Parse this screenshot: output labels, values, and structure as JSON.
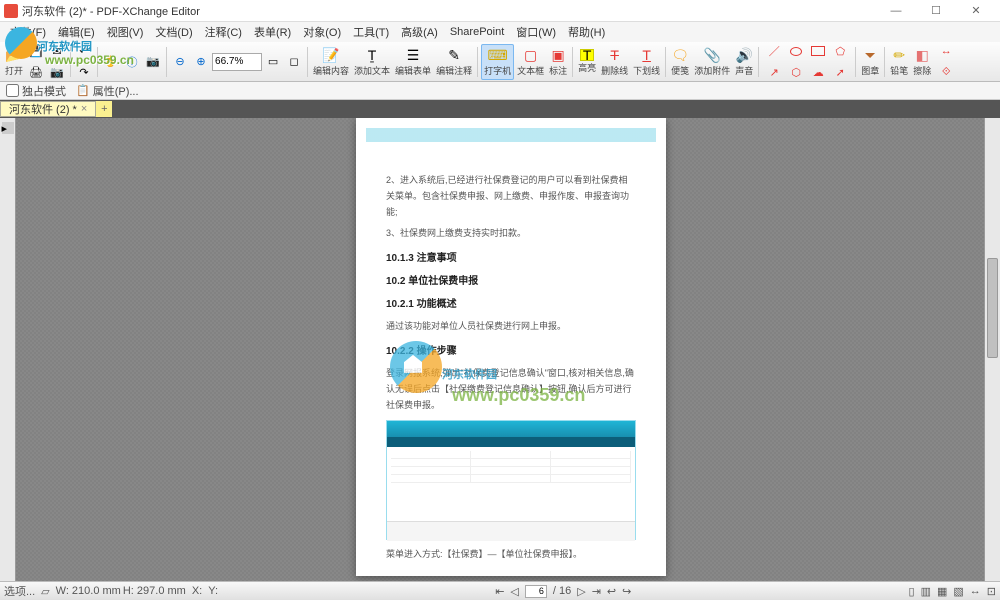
{
  "window": {
    "title": "河东软件 (2)* - PDF-XChange Editor",
    "minimize": "—",
    "maximize": "☐",
    "close": "✕"
  },
  "menu": {
    "file": "文件(F)",
    "edit": "编辑(E)",
    "view": "视图(V)",
    "document": "文档(D)",
    "annotate": "注释(C)",
    "form": "表单(R)",
    "object": "对象(O)",
    "tools": "工具(T)",
    "advanced": "高级(A)",
    "sharepoint": "SharePoint",
    "window": "窗口(W)",
    "help": "帮助(H)"
  },
  "toolbar": {
    "open": "打开",
    "zoom_value": "66.7%",
    "edit_content": "编辑内容",
    "add_text": "添加文本",
    "edit_form": "编辑表单",
    "edit_annot": "编辑注释",
    "typewriter": "打字机",
    "textbox": "文本框",
    "callout": "标注",
    "highlight": "高亮",
    "strike": "删除线",
    "underline": "下划线",
    "note": "便笺",
    "attach": "添加附件",
    "sound": "声音",
    "stamp": "图章",
    "erase": "擦除",
    "pencil": "铅笔"
  },
  "subbar": {
    "exclusive": "独占模式",
    "properties": "属性(P)..."
  },
  "tab": {
    "name": "河东软件 (2) *"
  },
  "doc": {
    "p1": "2、进入系统后,已经进行社保费登记的用户可以看到社保费相关菜单。包含社保费申报、网上缴费、申报作废、申报查询功能;",
    "p2": "3、社保费网上缴费支持实时扣款。",
    "h1": "10.1.3 注意事项",
    "h2": "10.2 单位社保费申报",
    "h3": "10.2.1 功能概述",
    "p3": "通过该功能对单位人员社保费进行网上申报。",
    "h4": "10.2.2 操作步骤",
    "p4": "登录网报系统,弹出\"社保费登记信息确认\"窗口,核对相关信息,确认无误后点击【社保缴费登记信息确认】按钮,确认后方可进行社保费申报。",
    "p5": "菜单进入方式:【社保费】—【单位社保费申报】。"
  },
  "status": {
    "options": "选项...",
    "w": "W: 210.0 mm",
    "h": "H: 297.0 mm",
    "x": "X:",
    "y": "Y:",
    "page_current": "6",
    "page_total": "/ 16"
  },
  "watermark": {
    "text": "河东软件园",
    "url": "www.pc0359.cn"
  },
  "colors": {
    "accent": "#2196c4",
    "wm_green": "#7cb342",
    "annot_red": "#e53935"
  }
}
